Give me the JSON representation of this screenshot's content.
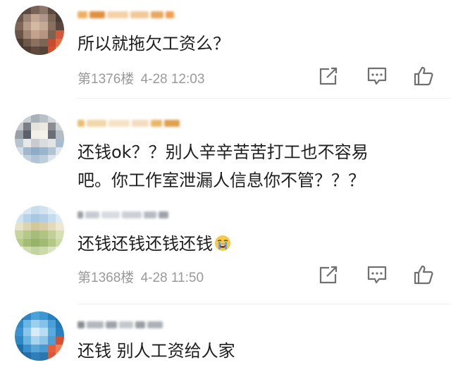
{
  "comments": [
    {
      "text_lines": [
        "所以就拖欠工资么？"
      ],
      "floor": "第1376楼",
      "time": "4-28 12:03",
      "has_actions": true
    },
    {
      "text_lines": [
        "还钱ok？？别人辛辛苦苦打工也不容易",
        "吧。你工作室泄漏人信息你不管？？？"
      ],
      "floor": "",
      "time": "",
      "has_actions": false
    },
    {
      "text_lines": [
        "还钱还钱还钱还钱"
      ],
      "emoji": "crying-face-emoji",
      "floor": "第1368楼",
      "time": "4-28 11:50",
      "has_actions": true
    },
    {
      "text_lines": [
        "还钱 别人工资给人家"
      ],
      "floor": "",
      "time": "",
      "has_actions": false
    }
  ],
  "icons": {
    "share": "share-icon",
    "reply": "comment-icon",
    "like": "thumbs-up-icon"
  },
  "colors": {
    "text": "#1e1e1e",
    "meta": "#9a9a9a",
    "username_accent": "#e8a040"
  }
}
